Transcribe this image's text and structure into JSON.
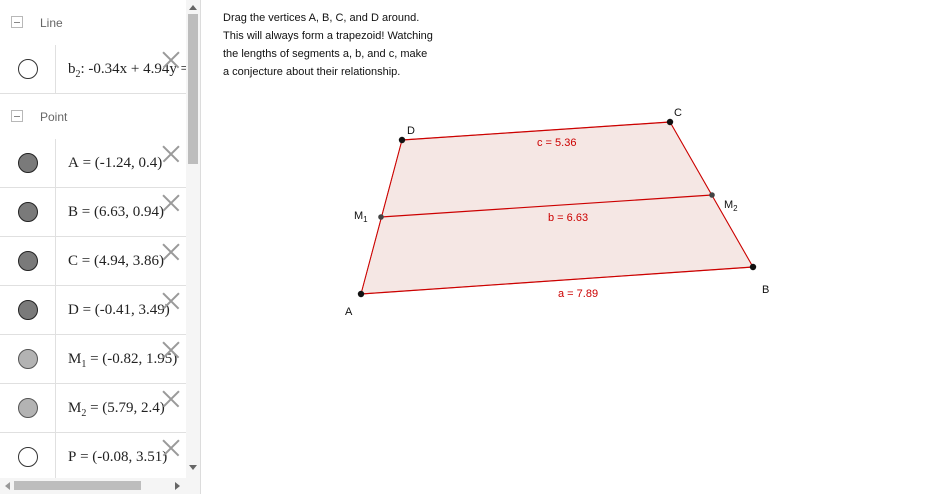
{
  "algebra": {
    "groups": [
      {
        "label": "Line"
      },
      {
        "label": "Point"
      }
    ],
    "items": [
      {
        "name": "b",
        "sub": "2",
        "rest": ": -0.34x + 4.94y =",
        "marble": "empty"
      },
      {
        "name": "A",
        "sub": "",
        "rest": " = (-1.24, 0.4)",
        "marble": "dark"
      },
      {
        "name": "B",
        "sub": "",
        "rest": " = (6.63, 0.94)",
        "marble": "dark"
      },
      {
        "name": "C",
        "sub": "",
        "rest": " = (4.94, 3.86)",
        "marble": "dark"
      },
      {
        "name": "D",
        "sub": "",
        "rest": " = (-0.41, 3.49)",
        "marble": "dark"
      },
      {
        "name": "M",
        "sub": "1",
        "rest": " = (-0.82, 1.95)",
        "marble": "light"
      },
      {
        "name": "M",
        "sub": "2",
        "rest": " = (5.79, 2.4)",
        "marble": "light"
      },
      {
        "name": "P",
        "sub": "",
        "rest": " = (-0.08, 3.51)",
        "marble": "empty"
      }
    ]
  },
  "graphics": {
    "instructions": [
      "Drag the vertices A, B, C, and D around.",
      "This will always form a trapezoid!  Watching",
      "the lengths of segments a, b, and c, make",
      "a conjecture about their relationship."
    ],
    "points": {
      "A": {
        "label": "A"
      },
      "B": {
        "label": "B"
      },
      "C": {
        "label": "C"
      },
      "D": {
        "label": "D"
      },
      "M1": {
        "label": "M",
        "sub": "1"
      },
      "M2": {
        "label": "M",
        "sub": "2"
      }
    },
    "segment_labels": {
      "a": "a = 7.89",
      "b": "b = 6.63",
      "c": "c = 5.36"
    },
    "colors": {
      "segment": "#cc0000",
      "fill": "#f5e7e4",
      "edge": "#d9695a",
      "point": "#111111"
    }
  }
}
